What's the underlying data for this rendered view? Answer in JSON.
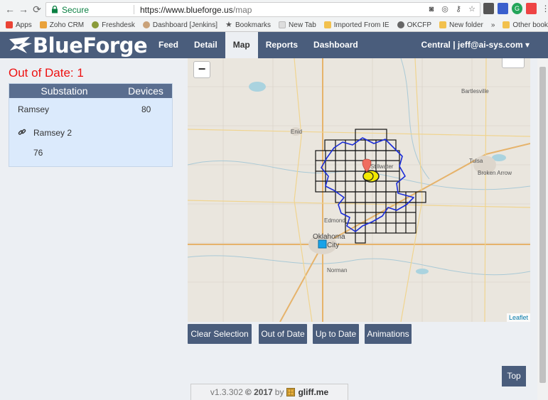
{
  "browser": {
    "secure_label": "Secure",
    "url_host": "https://www.blueforge.us",
    "url_path": "/map",
    "bookmarks": [
      "Apps",
      "Zoho CRM",
      "Freshdesk",
      "Dashboard [Jenkins]",
      "Bookmarks",
      "New Tab",
      "Imported From IE",
      "OKCFP",
      "New folder",
      "»",
      "Other bookmarks"
    ]
  },
  "app": {
    "logo_part1": "Blue",
    "logo_part2": "Forge",
    "nav": [
      "Feed",
      "Detail",
      "Map",
      "Reports",
      "Dashboard"
    ],
    "active_nav": "Map",
    "user": "Central | jeff@ai-sys.com"
  },
  "panel": {
    "title": "Out of Date: 1",
    "headers": {
      "substation": "Substation",
      "devices": "Devices"
    },
    "rows": [
      {
        "name": "Ramsey",
        "devices": "80"
      },
      {
        "name": "Ramsey 2",
        "devices": "76"
      }
    ]
  },
  "map": {
    "zoom_out": "−",
    "attribution": "Leaflet",
    "labels": {
      "bartlesville": "Bartlesville",
      "enid": "Enid",
      "tulsa": "Tulsa",
      "broken_arrow": "Broken Arrow",
      "edmond": "Edmond",
      "oklahoma": "Oklahoma",
      "city": "City",
      "norman": "Norman",
      "stillwater": "Stillwater"
    }
  },
  "buttons": {
    "clear_selection": "Clear Selection",
    "out_of_date": "Out of Date",
    "up_to_date": "Up to Date",
    "animations": "Animations",
    "top": "Top"
  },
  "footer": {
    "version": "v1.3.302",
    "copyright": "© 2017",
    "by": "by",
    "brand": "gliff.me"
  }
}
